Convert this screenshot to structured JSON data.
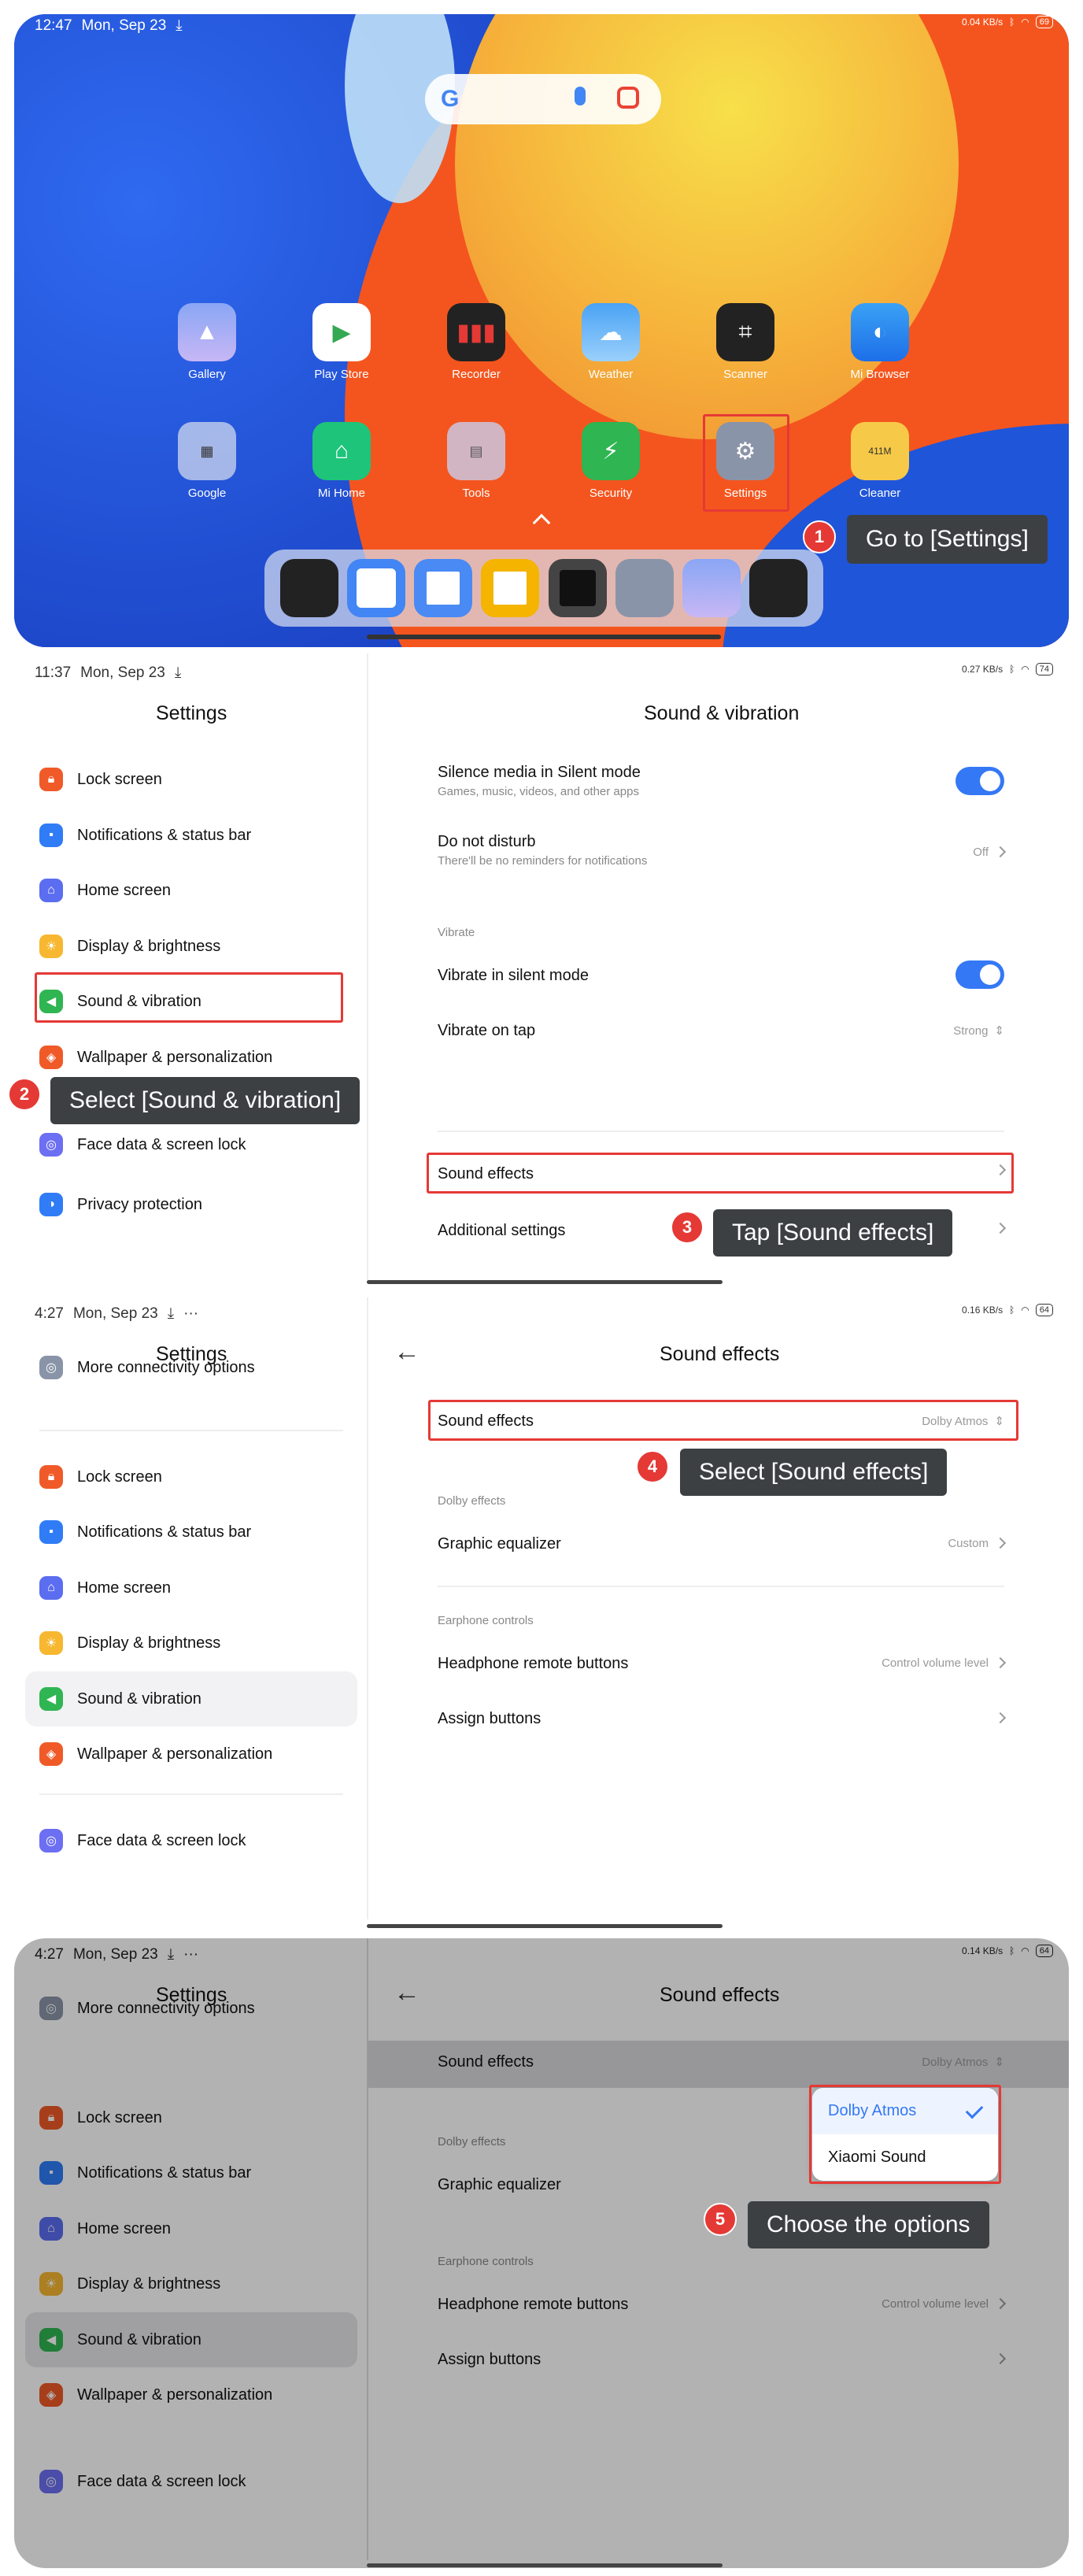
{
  "panel1": {
    "status": {
      "time": "12:47",
      "date": "Mon, Sep 23",
      "speed": "0.04 KB/s",
      "battery": "69"
    },
    "apps_row1": [
      "Gallery",
      "Play Store",
      "Recorder",
      "Weather",
      "Scanner",
      "Mi Browser"
    ],
    "apps_row2": [
      "Google",
      "Mi Home",
      "Tools",
      "Security",
      "Settings",
      "Cleaner"
    ],
    "cleaner_badge": "411M",
    "callout": {
      "num": "1",
      "text": "Go to [Settings]"
    }
  },
  "panel2": {
    "status": {
      "time": "11:37",
      "date": "Mon, Sep 23",
      "speed": "0.27 KB/s",
      "battery": "74"
    },
    "sidebar_title": "Settings",
    "sidebar_items": [
      "Lock screen",
      "Notifications & status bar",
      "Home screen",
      "Display & brightness",
      "Sound & vibration",
      "Wallpaper & personalization",
      "Face data & screen lock",
      "Privacy protection"
    ],
    "main_title": "Sound & vibration",
    "silence": {
      "title": "Silence media in Silent mode",
      "subtitle": "Games, music, videos, and other apps"
    },
    "dnd": {
      "title": "Do not disturb",
      "subtitle": "There'll be no reminders for notifications",
      "value": "Off"
    },
    "vibrate_section": "Vibrate",
    "vibrate_silent": "Vibrate in silent mode",
    "vibrate_tap": {
      "title": "Vibrate on tap",
      "value": "Strong"
    },
    "sound_effects": "Sound effects",
    "additional": "Additional settings",
    "callout2": {
      "num": "2",
      "text": "Select [Sound & vibration]"
    },
    "callout3": {
      "num": "3",
      "text": "Tap [Sound effects]"
    }
  },
  "panel3": {
    "status": {
      "time": "4:27",
      "date": "Mon, Sep 23",
      "speed": "0.16 KB/s",
      "battery": "64"
    },
    "sidebar_title": "Settings",
    "sidebar_top": "More connectivity options",
    "sidebar_items": [
      "Lock screen",
      "Notifications & status bar",
      "Home screen",
      "Display & brightness",
      "Sound & vibration",
      "Wallpaper & personalization",
      "Face data & screen lock"
    ],
    "main_title": "Sound effects",
    "sound_effects": {
      "title": "Sound effects",
      "value": "Dolby Atmos"
    },
    "dolby_section": "Dolby effects",
    "equalizer": {
      "title": "Graphic equalizer",
      "value": "Custom"
    },
    "earphone_section": "Earphone controls",
    "headphone": {
      "title": "Headphone remote buttons",
      "value": "Control volume level"
    },
    "assign": "Assign buttons",
    "callout": {
      "num": "4",
      "text": "Select [Sound effects]"
    }
  },
  "panel4": {
    "status": {
      "time": "4:27",
      "date": "Mon, Sep 23",
      "speed": "0.14 KB/s",
      "battery": "64"
    },
    "options": [
      "Dolby Atmos",
      "Xiaomi Sound"
    ],
    "callout": {
      "num": "5",
      "text": "Choose the options"
    }
  },
  "colors": {
    "accent": "#3478f6",
    "highlight": "#e53935",
    "callout_bg": "#3c4043"
  }
}
